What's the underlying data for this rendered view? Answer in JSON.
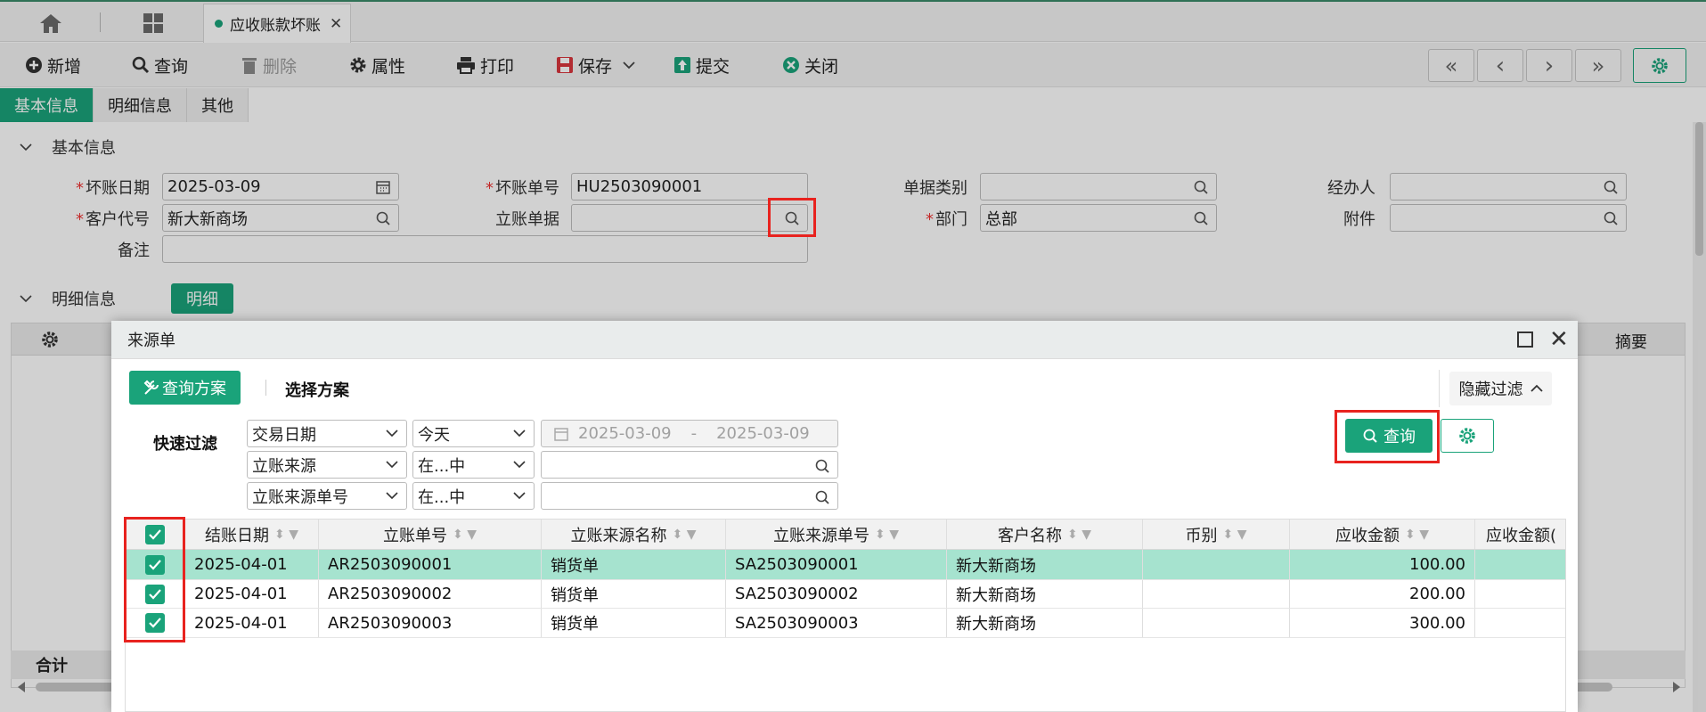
{
  "tabs": {
    "home_icon": "home-icon",
    "grid_icon": "grid-icon",
    "active_tab": "应收账款坏账",
    "close_glyph": "✕"
  },
  "toolbar": {
    "add": "新增",
    "query": "查询",
    "delete": "删除",
    "attributes": "属性",
    "print": "打印",
    "save": "保存",
    "submit": "提交",
    "close": "关闭",
    "nav_first": "«",
    "nav_prev": "‹",
    "nav_next": "›",
    "nav_last": "»"
  },
  "subtabs": [
    "基本信息",
    "明细信息",
    "其他"
  ],
  "basic": {
    "section_title": "基本信息",
    "bad_date_label": "坏账日期",
    "bad_date_value": "2025-03-09",
    "bad_no_label": "坏账单号",
    "bad_no_value": "HU2503090001",
    "doc_type_label": "单据类别",
    "doc_type_value": "",
    "handler_label": "经办人",
    "handler_value": "",
    "customer_label": "客户代号",
    "customer_value": "新大新商场",
    "ledger_doc_label": "立账单据",
    "ledger_doc_value": "",
    "dept_label": "部门",
    "dept_value": "总部",
    "attach_label": "附件",
    "attach_value": "",
    "remark_label": "备注",
    "remark_value": ""
  },
  "detail": {
    "section_title": "明细信息",
    "detail_button": "明细",
    "col_summary": "摘要",
    "total_label": "合计"
  },
  "dialog": {
    "title": "来源单",
    "query_plan_button": "查询方案",
    "select_plan": "选择方案",
    "hide_filter": "隐藏过滤",
    "quick_filter": "快速过滤",
    "filters": [
      {
        "field": "交易日期",
        "op": "今天",
        "value_from": "2025-03-09",
        "sep": "-",
        "value_to": "2025-03-09"
      },
      {
        "field": "立账来源",
        "op": "在...中",
        "value": ""
      },
      {
        "field": "立账来源单号",
        "op": "在...中",
        "value": ""
      }
    ],
    "query_button": "查询",
    "columns": [
      "结账日期",
      "立账单号",
      "立账来源名称",
      "立账来源单号",
      "客户名称",
      "币别",
      "应收金额",
      "应收金额("
    ],
    "rows": [
      {
        "date": "2025-04-01",
        "ar_no": "AR2503090001",
        "source_name": "销货单",
        "source_no": "SA2503090001",
        "customer": "新大新商场",
        "currency": "",
        "amount": "100.00",
        "amount2": ""
      },
      {
        "date": "2025-04-01",
        "ar_no": "AR2503090002",
        "source_name": "销货单",
        "source_no": "SA2503090002",
        "customer": "新大新商场",
        "currency": "",
        "amount": "200.00",
        "amount2": ""
      },
      {
        "date": "2025-04-01",
        "ar_no": "AR2503090003",
        "source_name": "销货单",
        "source_no": "SA2503090003",
        "customer": "新大新商场",
        "currency": "",
        "amount": "300.00",
        "amount2": ""
      }
    ]
  },
  "colors": {
    "accent": "#1aa37a",
    "selected_row": "#a6e3cf",
    "highlight": "#e8231f",
    "required": "#e33333"
  }
}
